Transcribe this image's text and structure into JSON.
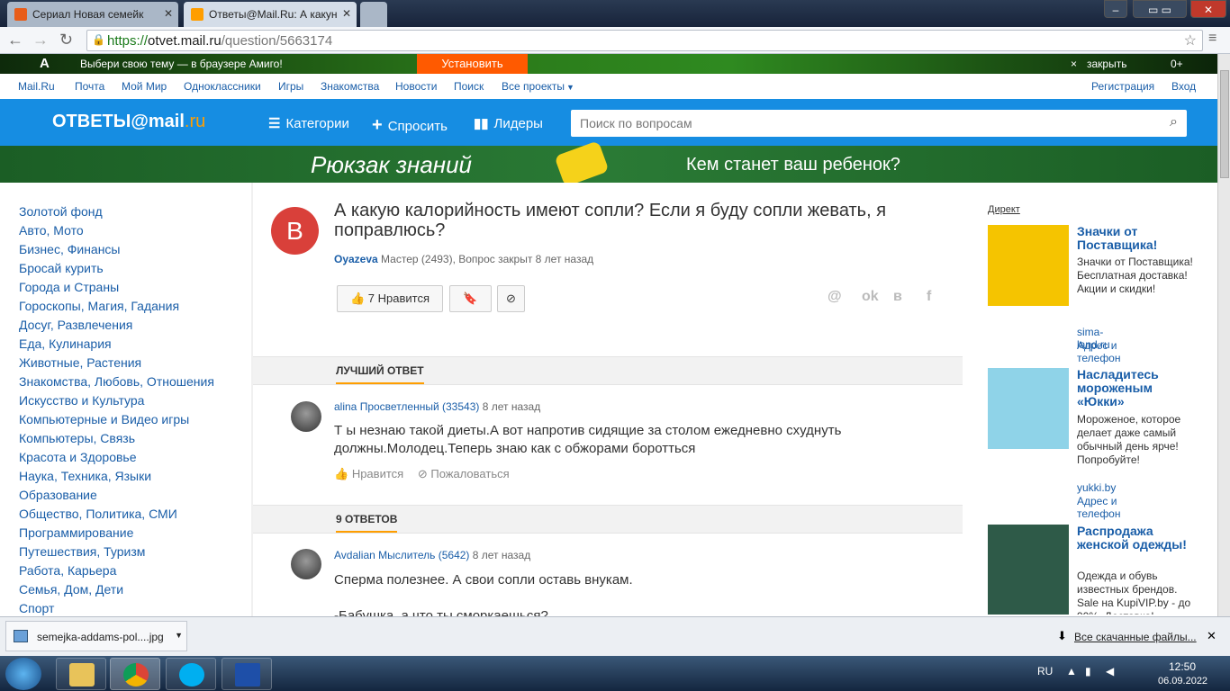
{
  "browser": {
    "tabs": [
      {
        "title": "Сериал Новая семейк"
      },
      {
        "title": "Ответы@Mail.Ru: А какун"
      }
    ],
    "url_scheme": "https://",
    "url_host": "otvet.mail.ru",
    "url_path": "/question/5663174"
  },
  "promo": {
    "text": "Выбери свою тему — в браузере Амиго!",
    "install": "Установить",
    "close": "закрыть",
    "rating": "0+"
  },
  "topnav": {
    "items": [
      "Mail.Ru",
      "Почта",
      "Мой Мир",
      "Одноклассники",
      "Игры",
      "Знакомства",
      "Новости",
      "Поиск",
      "Все проекты"
    ],
    "register": "Регистрация",
    "login": "Вход"
  },
  "header": {
    "logo_main": "ОТВЕТЫ@",
    "logo_brand": "mail",
    "logo_dom": ".ru",
    "categories": "Категории",
    "ask": "Спросить",
    "leaders": "Лидеры",
    "search_placeholder": "Поиск по вопросам"
  },
  "banner": {
    "title": "Рюкзак знаний",
    "subtitle": "Кем станет ваш ребенок?"
  },
  "sidebar": {
    "categories": [
      "Золотой фонд",
      "Авто, Мото",
      "Бизнес, Финансы",
      "Бросай курить",
      "Города и Страны",
      "Гороскопы, Магия, Гадания",
      "Досуг, Развлечения",
      "Еда, Кулинария",
      "Животные, Растения",
      "Знакомства, Любовь, Отношения",
      "Искусство и Культура",
      "Компьютерные и Видео игры",
      "Компьютеры, Связь",
      "Красота и Здоровье",
      "Наука, Техника, Языки",
      "Образование",
      "Общество, Политика, СМИ",
      "Программирование",
      "Путешествия, Туризм",
      "Работа, Карьера",
      "Семья, Дом, Дети",
      "Спорт"
    ]
  },
  "question": {
    "avatar_letter": "B",
    "title": "А какую калорийность имеют сопли? Если я буду сопли жевать, я поправлюсь?",
    "author": "Oyazeva",
    "meta": "Мастер (2493), Вопрос закрыт 8 лет назад",
    "likes": "7",
    "like_label": "Нравится",
    "share_icons": [
      "@",
      "ok",
      "в",
      "f"
    ]
  },
  "best_answer": {
    "section_label": "ЛУЧШИЙ ОТВЕТ",
    "author": "alina",
    "level": "Просветленный (33543)",
    "time": "8 лет назад",
    "text": "Т ы незнаю такой диеты.А вот напротив сидящие за столом ежедневно схудну​ть должны.Молодец.Теперь знаю как с обжорами боротться",
    "like": "Нравится",
    "report": "Пожаловаться"
  },
  "answers": {
    "section_label": "9 ОТВЕТОВ",
    "first": {
      "author": "Avdalian",
      "level": "Мыслитель (5642)",
      "time": "8 лет назад",
      "text": "Сперма полезнее. А свои сопли оставь внукам.",
      "text2": "-Бабушка, а что ты сморкаешься?"
    }
  },
  "ads": {
    "label": "Директ",
    "items": [
      {
        "title": "Значки от Поставщика!",
        "desc": "Значки от Поставщика! Бесплатная доставка! Акции и скидки!",
        "site": "sima-land.ru",
        "contact": "Адрес и телефон",
        "color": "#f5c400"
      },
      {
        "title": "Насладитесь мороженым «Юкки»",
        "desc": "Мороженое, которое делает даже самый обычный день ярче! Попробуйте!",
        "site": "yukki.by",
        "contact": "Адрес и телефон",
        "color": "#8fd3e8"
      },
      {
        "title": "Распродажа женской одежды!",
        "desc": "Одежда и обувь известных брендов. Sale на KupiVIP.by - до 90%. Доставка!",
        "color": "#2e5a48"
      }
    ]
  },
  "downloads": {
    "file": "semejka-addams-pol....jpg",
    "all": "Все скачанные файлы..."
  },
  "taskbar": {
    "lang": "RU",
    "time": "12:50",
    "date": "06.09.2022"
  }
}
